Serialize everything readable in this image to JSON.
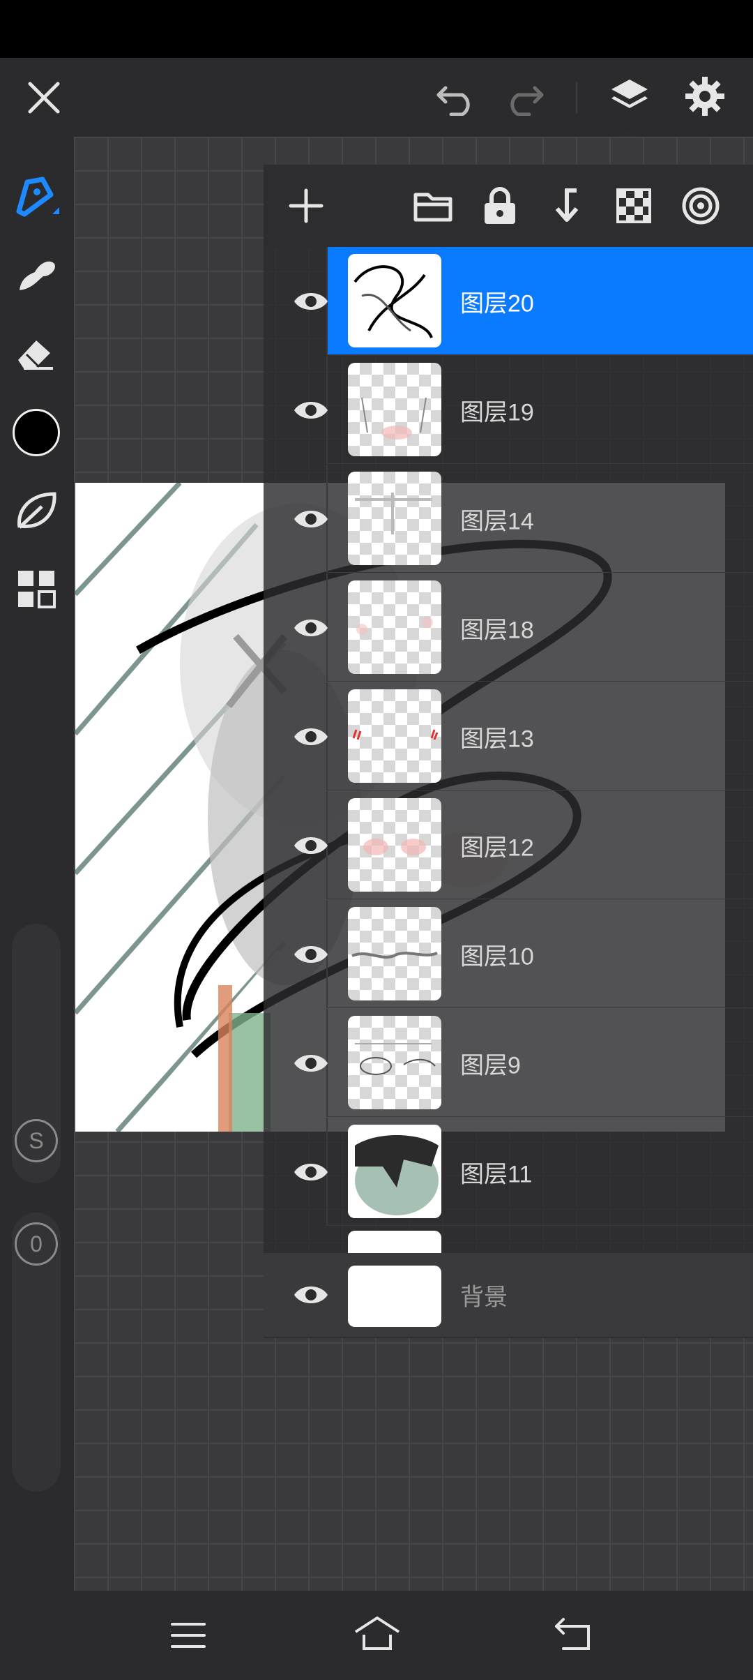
{
  "topbar": {
    "close_icon": "close-icon",
    "undo_icon": "undo-icon",
    "redo_icon": "redo-icon",
    "layers_icon": "layers-icon",
    "settings_icon": "gear-icon"
  },
  "tools": [
    "brush-tool-icon",
    "smudge-tool-icon",
    "eraser-tool-icon",
    "color-swatch",
    "leaf-icon",
    "grid-apps-icon"
  ],
  "colors": {
    "accent": "#0a7bff",
    "current_color": "#000000"
  },
  "sliders": {
    "size_label": "S",
    "opacity_label": "0"
  },
  "layers_panel": {
    "toolbar": [
      "add-layer-icon",
      "folder-icon",
      "lock-icon",
      "merge-down-icon",
      "checkerboard-icon",
      "target-icon"
    ],
    "layers": [
      {
        "name": "图层20",
        "selected": true
      },
      {
        "name": "图层19",
        "selected": false
      },
      {
        "name": "图层14",
        "selected": false
      },
      {
        "name": "图层18",
        "selected": false
      },
      {
        "name": "图层13",
        "selected": false
      },
      {
        "name": "图层12",
        "selected": false
      },
      {
        "name": "图层10",
        "selected": false
      },
      {
        "name": "图层9",
        "selected": false
      },
      {
        "name": "图层11",
        "selected": false
      }
    ],
    "background_label": "背景"
  },
  "navbar": [
    "menu-icon",
    "home-icon",
    "back-icon"
  ]
}
